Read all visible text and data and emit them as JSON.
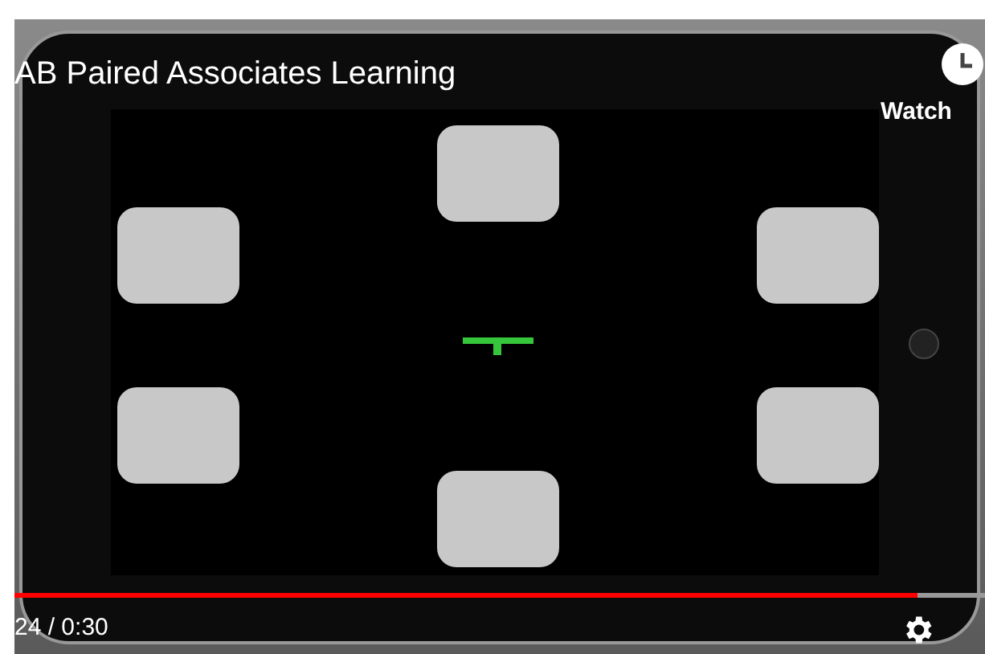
{
  "title": "AB Paired Associates Learning",
  "watch_later": "Watch",
  "progress": {
    "level": 0.93
  },
  "time": "24 / 0:30"
}
